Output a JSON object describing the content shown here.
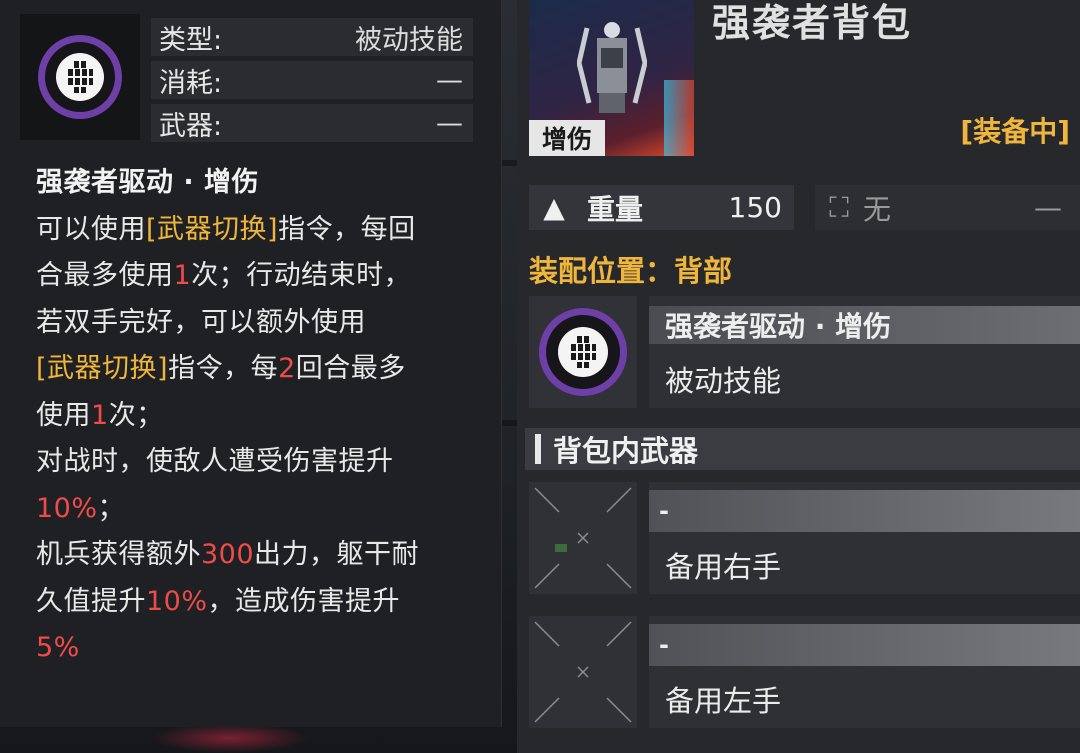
{
  "tooltip": {
    "info": [
      {
        "label": "类型:",
        "value": "被动技能"
      },
      {
        "label": "消耗:",
        "value": "—"
      },
      {
        "label": "武器:",
        "value": "—"
      }
    ],
    "title": "强袭者驱动 · 增伤",
    "lines": {
      "l1a": "可以使用",
      "l1b": "[武器切换]",
      "l1c": "指令，每回",
      "l2a": "合最多使用",
      "l2b": "1",
      "l2c": "次；行动结束时，",
      "l3": "若双手完好，可以额外使用",
      "l4a": "[武器切换]",
      "l4b": "指令，每",
      "l4c": "2",
      "l4d": "回合最多",
      "l5a": "使用",
      "l5b": "1",
      "l5c": "次；",
      "l6": "对战时，使敌人遭受伤害提升",
      "l7a": "10%",
      "l7b": "；",
      "l8a": "机兵获得额外",
      "l8b": "300",
      "l8c": "出力，躯干耐",
      "l9a": "久值提升",
      "l9b": "10%",
      "l9c": "，造成伤害提升",
      "l10": "5%"
    }
  },
  "item": {
    "name": "强袭者背包",
    "tag": "增伤",
    "status": "[装备中]",
    "weight_label": "重量",
    "weight_value": "150",
    "slot2_label": "无",
    "slot2_value": "—",
    "equip_slot": "装配位置：背部"
  },
  "skill": {
    "name": "强袭者驱动 · 增伤",
    "type": "被动技能"
  },
  "weapons_section": "背包内武器",
  "weapons": [
    {
      "name": "-",
      "slot": "备用右手"
    },
    {
      "name": "-",
      "slot": "备用左手"
    }
  ],
  "colors": {
    "accent_yellow": "#f0b63c",
    "highlight_red": "#ef4b4b",
    "ring_purple": "#6e3fa7"
  }
}
